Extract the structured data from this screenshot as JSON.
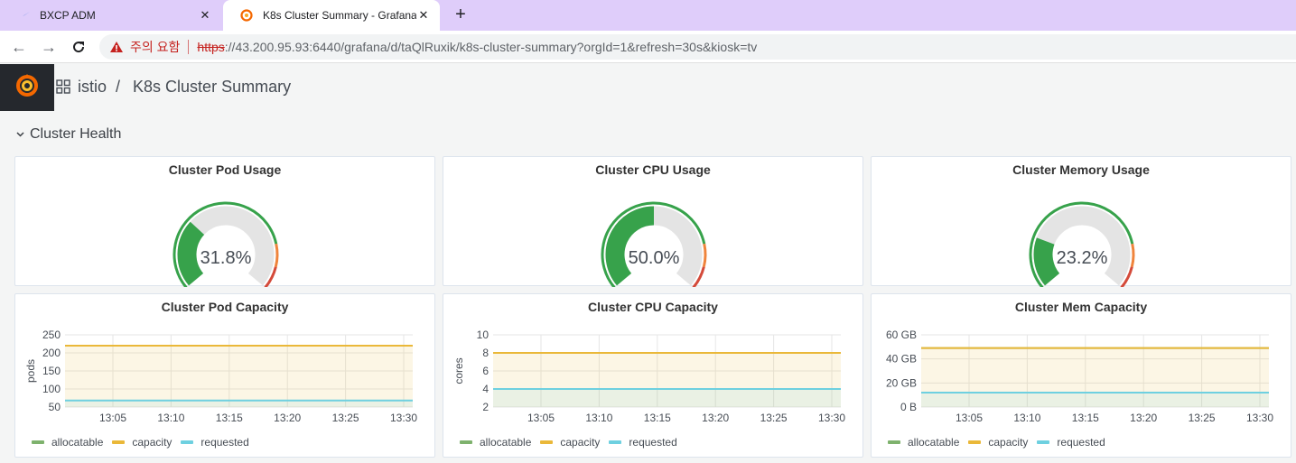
{
  "browser": {
    "tabs": [
      {
        "title": "BXCP ADM",
        "active": false
      },
      {
        "title": "K8s Cluster Summary - Grafana",
        "active": true
      }
    ],
    "warning_text": "주의 요함",
    "url_proto": "https",
    "url_rest": "://43.200.95.93:6440/grafana/d/taQlRuxik/k8s-cluster-summary?orgId=1&refresh=30s&kiosk=tv"
  },
  "breadcrumb": {
    "folder": "istio",
    "separator": "/",
    "dashboard": "K8s Cluster Summary"
  },
  "row": {
    "title": "Cluster Health"
  },
  "colors": {
    "green": "#37a24b",
    "orange": "#ef843c",
    "red": "#d44a3a",
    "allocatable": "#7eb26d",
    "capacity": "#eab839",
    "requested": "#6ed0e0"
  },
  "gauges": [
    {
      "title": "Cluster Pod Usage",
      "value": 31.8,
      "display": "31.8%"
    },
    {
      "title": "Cluster CPU Usage",
      "value": 50.0,
      "display": "50.0%"
    },
    {
      "title": "Cluster Memory Usage",
      "value": 23.2,
      "display": "23.2%"
    }
  ],
  "legend_labels": [
    "allocatable",
    "capacity",
    "requested"
  ],
  "chart_data": [
    {
      "type": "line",
      "title": "Cluster Pod Capacity",
      "ylabel": "pods",
      "yticks": [
        "250",
        "200",
        "150",
        "100",
        "50"
      ],
      "ylim": [
        50,
        250
      ],
      "xticks": [
        "13:05",
        "13:10",
        "13:15",
        "13:20",
        "13:25",
        "13:30"
      ],
      "series": [
        {
          "name": "allocatable",
          "values": [
            220,
            220
          ]
        },
        {
          "name": "capacity",
          "values": [
            220,
            220
          ]
        },
        {
          "name": "requested",
          "values": [
            68,
            68
          ]
        }
      ]
    },
    {
      "type": "line",
      "title": "Cluster CPU Capacity",
      "ylabel": "cores",
      "yticks": [
        "10",
        "8",
        "6",
        "4",
        "2"
      ],
      "ylim": [
        2,
        10
      ],
      "xticks": [
        "13:05",
        "13:10",
        "13:15",
        "13:20",
        "13:25",
        "13:30"
      ],
      "series": [
        {
          "name": "allocatable",
          "values": [
            8,
            8
          ]
        },
        {
          "name": "capacity",
          "values": [
            8,
            8
          ]
        },
        {
          "name": "requested",
          "values": [
            4,
            4
          ]
        }
      ]
    },
    {
      "type": "line",
      "title": "Cluster Mem Capacity",
      "ylabel": "",
      "yticks": [
        "60 GB",
        "40 GB",
        "20 GB",
        "0 B"
      ],
      "ylim": [
        0,
        60
      ],
      "xticks": [
        "13:05",
        "13:10",
        "13:15",
        "13:20",
        "13:25",
        "13:30"
      ],
      "series": [
        {
          "name": "allocatable",
          "values": [
            49,
            49
          ]
        },
        {
          "name": "capacity",
          "values": [
            49,
            49
          ]
        },
        {
          "name": "requested",
          "values": [
            12,
            12
          ]
        }
      ]
    }
  ]
}
